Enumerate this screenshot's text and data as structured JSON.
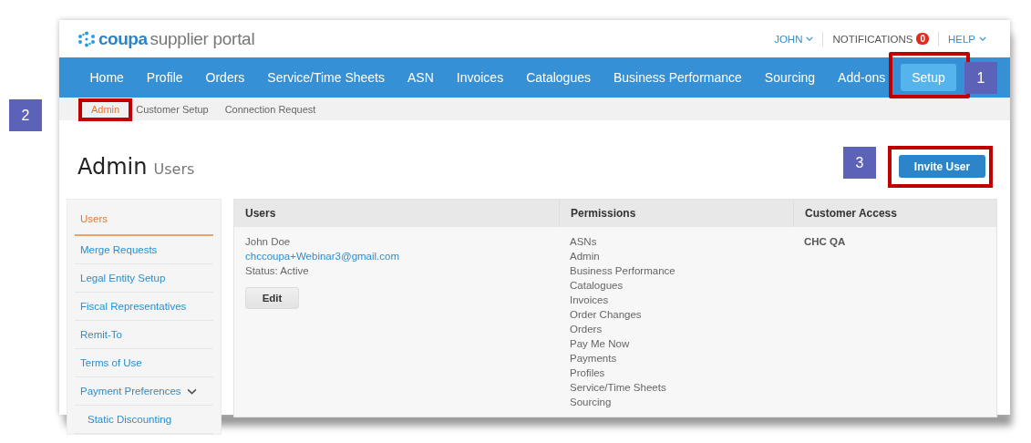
{
  "header": {
    "logo": "coupa",
    "logo_suffix": "supplier portal",
    "user_menu": "JOHN",
    "notifications": {
      "label": "NOTIFICATIONS",
      "count": "0"
    },
    "help": "HELP"
  },
  "nav": [
    {
      "label": "Home",
      "selected": false,
      "highlighted": false
    },
    {
      "label": "Profile",
      "selected": false,
      "highlighted": false
    },
    {
      "label": "Orders",
      "selected": false,
      "highlighted": false
    },
    {
      "label": "Service/Time Sheets",
      "selected": false,
      "highlighted": false
    },
    {
      "label": "ASN",
      "selected": false,
      "highlighted": false
    },
    {
      "label": "Invoices",
      "selected": false,
      "highlighted": false
    },
    {
      "label": "Catalogues",
      "selected": false,
      "highlighted": false
    },
    {
      "label": "Business Performance",
      "selected": false,
      "highlighted": false
    },
    {
      "label": "Sourcing",
      "selected": false,
      "highlighted": false
    },
    {
      "label": "Add-ons",
      "selected": false,
      "highlighted": false
    },
    {
      "label": "Setup",
      "selected": true,
      "highlighted": true
    }
  ],
  "subnav": [
    {
      "label": "Admin",
      "selected": true,
      "highlighted": true
    },
    {
      "label": "Customer Setup",
      "selected": false,
      "highlighted": false
    },
    {
      "label": "Connection Request",
      "selected": false,
      "highlighted": false
    }
  ],
  "page_title": {
    "title": "Admin",
    "subtitle": "Users"
  },
  "invite_button": {
    "label": "Invite User",
    "highlighted": true
  },
  "sidebar": [
    {
      "label": "Users",
      "selected": true
    },
    {
      "label": "Merge Requests",
      "selected": false
    },
    {
      "label": "Legal Entity Setup",
      "selected": false
    },
    {
      "label": "Fiscal Representatives",
      "selected": false
    },
    {
      "label": "Remit-To",
      "selected": false
    },
    {
      "label": "Terms of Use",
      "selected": false
    },
    {
      "label": "Payment Preferences",
      "selected": false,
      "expanded": true,
      "children": [
        {
          "label": "Static Discounting",
          "selected": false
        }
      ]
    }
  ],
  "table": {
    "columns": [
      "Users",
      "Permissions",
      "Customer Access"
    ],
    "rows": [
      {
        "name": "John Doe",
        "email": "chccoupa+Webinar3@gmail.com",
        "status": "Status: Active",
        "edit_button": "Edit",
        "permissions": [
          "ASNs",
          "Admin",
          "Business Performance",
          "Catalogues",
          "Invoices",
          "Order Changes",
          "Orders",
          "Pay Me Now",
          "Payments",
          "Profiles",
          "Service/Time Sheets",
          "Sourcing"
        ],
        "customer_access": "CHC QA"
      }
    ]
  },
  "callouts": [
    "1",
    "2",
    "3"
  ]
}
